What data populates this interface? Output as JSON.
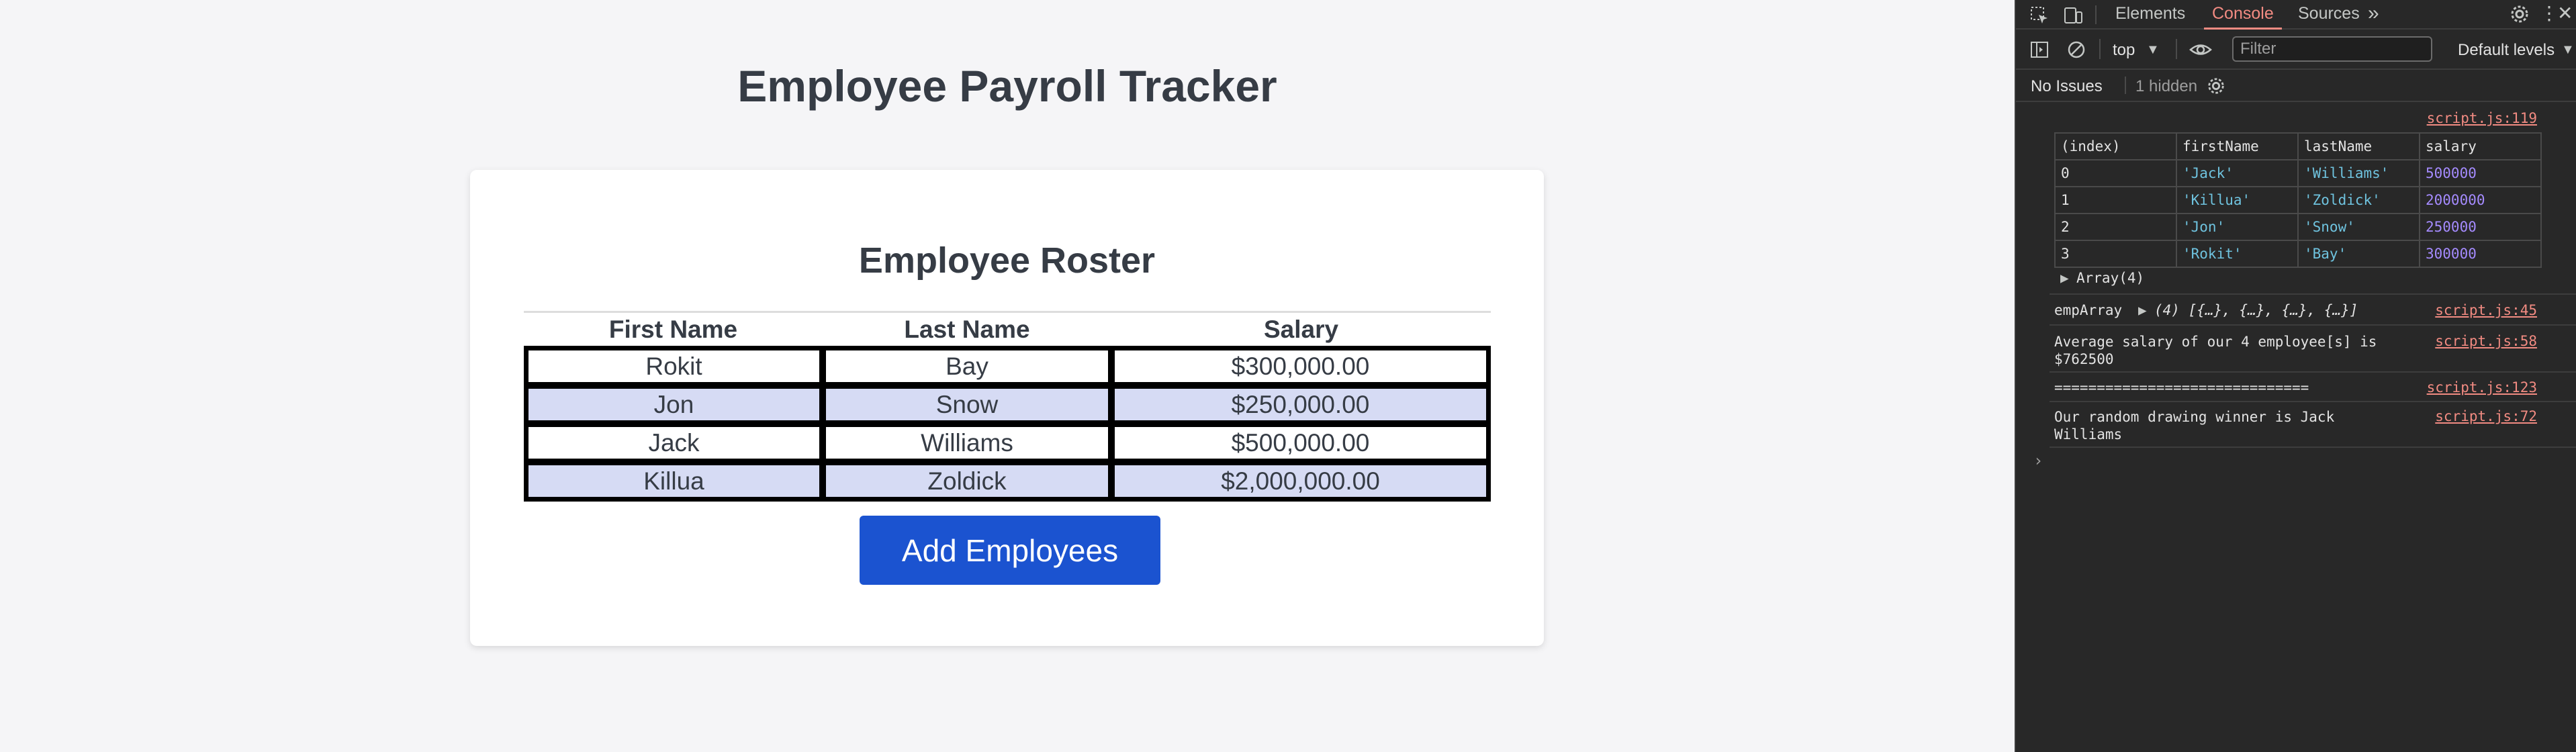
{
  "app": {
    "title": "Employee Payroll Tracker",
    "roster": {
      "title": "Employee Roster",
      "headers": [
        "First Name",
        "Last Name",
        "Salary"
      ],
      "rows": [
        {
          "first": "Rokit",
          "last": "Bay",
          "salary": "$300,000.00"
        },
        {
          "first": "Jon",
          "last": "Snow",
          "salary": "$250,000.00"
        },
        {
          "first": "Jack",
          "last": "Williams",
          "salary": "$500,000.00"
        },
        {
          "first": "Killua",
          "last": "Zoldick",
          "salary": "$2,000,000.00"
        }
      ]
    },
    "add_button": "Add Employees",
    "colors": {
      "button": "#1b53d0",
      "row_alt": "#d6dbf4",
      "text": "#363c45"
    }
  },
  "devtools": {
    "tabs": [
      "Elements",
      "Console",
      "Sources"
    ],
    "active_tab": "Console",
    "context": "top",
    "filter_placeholder": "Filter",
    "levels": "Default levels",
    "issues": "No Issues",
    "hidden": "1 hidden",
    "table_source": "script.js:119",
    "table_headers": [
      "(index)",
      "firstName",
      "lastName",
      "salary"
    ],
    "table_rows": [
      [
        "0",
        "'Jack'",
        "'Williams'",
        "500000"
      ],
      [
        "1",
        "'Killua'",
        "'Zoldick'",
        "2000000"
      ],
      [
        "2",
        "'Jon'",
        "'Snow'",
        "250000"
      ],
      [
        "3",
        "'Rokit'",
        "'Bay'",
        "300000"
      ]
    ],
    "array_label": "Array(4)",
    "messages": [
      {
        "text": "empArray",
        "detail": "(4) [{…}, {…}, {…}, {…}]",
        "source": "script.js:45"
      },
      {
        "text": "Average salary of our 4 employee[s] is $762500",
        "source": "script.js:58"
      },
      {
        "text": "==============================",
        "source": "script.js:123"
      },
      {
        "text": "Our random drawing winner is Jack Williams",
        "source": "script.js:72"
      }
    ],
    "icons": [
      "inspect-icon",
      "device-toggle-icon",
      "more-tabs-icon",
      "settings-icon",
      "kebab-menu-icon",
      "close-icon",
      "sidebar-icon",
      "clear-icon",
      "eye-icon",
      "gear-icon",
      "prompt-icon"
    ]
  }
}
